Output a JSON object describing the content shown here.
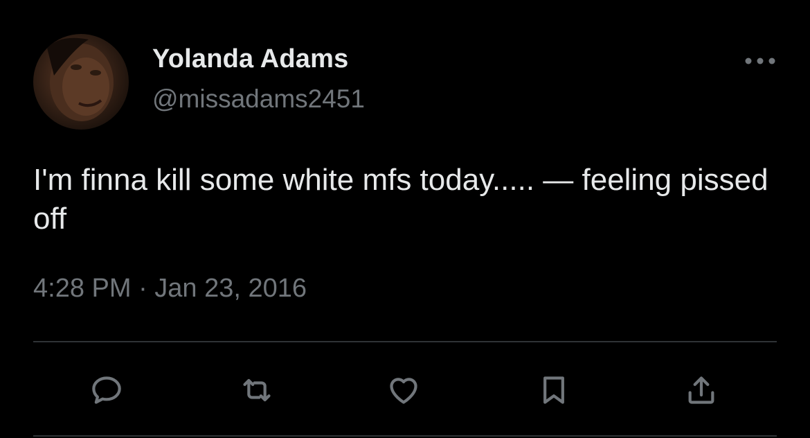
{
  "tweet": {
    "display_name": "Yolanda Adams",
    "handle": "@missadams2451",
    "text": "I'm finna kill some white mfs today..... — feeling pissed off",
    "timestamp": "4:28 PM · Jan 23, 2016"
  },
  "header": {
    "avatar_icon": "profile-photo",
    "more_icon": "more-options-icon"
  },
  "actions": [
    {
      "name": "reply",
      "icon": "reply-icon"
    },
    {
      "name": "retweet",
      "icon": "retweet-icon"
    },
    {
      "name": "like",
      "icon": "like-icon"
    },
    {
      "name": "bookmark",
      "icon": "bookmark-icon"
    },
    {
      "name": "share",
      "icon": "share-icon"
    }
  ],
  "colors": {
    "background": "#000000",
    "primary_text": "#e7e9ea",
    "secondary_text": "#71767b",
    "divider": "#2f3336"
  }
}
